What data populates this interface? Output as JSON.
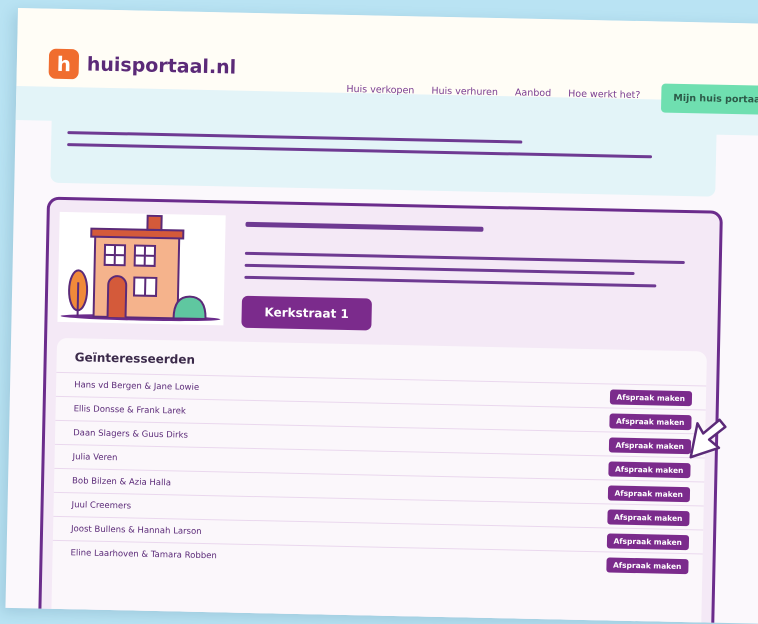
{
  "brand": {
    "logo_letter": "h",
    "name": "huisportaal.nl"
  },
  "nav": {
    "items": [
      "Huis verkopen",
      "Huis verhuren",
      "Aanbod",
      "Hoe werkt het?"
    ],
    "cta": "Mijn huis portaal"
  },
  "property": {
    "address_button": "Kerkstraat 1"
  },
  "interested": {
    "title": "Geïnteresseerden",
    "button_label": "Afspraak maken",
    "rows": [
      "Hans vd Bergen & Jane Lowie",
      "Ellis Donsse & Frank Larek",
      "Daan Slagers & Guus Dirks",
      "Julia Veren",
      "Bob Bilzen & Azia Halla",
      "Juul Creemers",
      "Joost Bullens & Hannah Larson",
      "Eline Laarhoven & Tamara Robben"
    ]
  },
  "colors": {
    "accent": "#7b2b8c",
    "cta": "#6fdfb0",
    "logo": "#f06d2f"
  },
  "icons": {
    "cursor": "pointer-arrow-icon",
    "house": "house-illustration"
  }
}
